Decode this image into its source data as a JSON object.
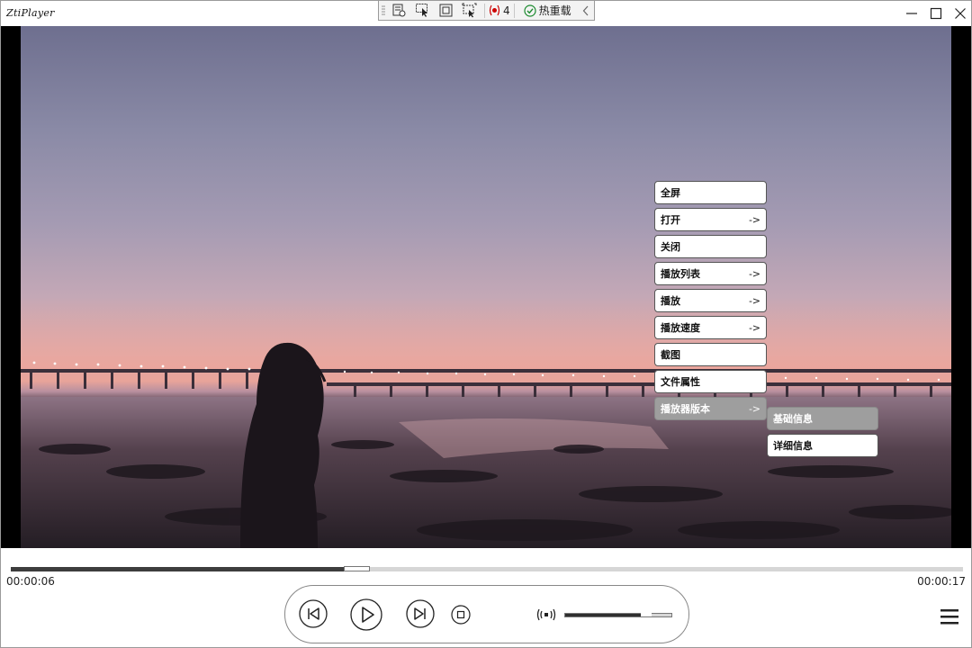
{
  "window": {
    "title": "ZtiPlayer"
  },
  "devbar": {
    "error_count": "4",
    "hot_reload_label": "热重载"
  },
  "context_menu": {
    "items": [
      {
        "label": "全屏",
        "has_sub": false
      },
      {
        "label": "打开",
        "has_sub": true
      },
      {
        "label": "关闭",
        "has_sub": false
      },
      {
        "label": "播放列表",
        "has_sub": true
      },
      {
        "label": "播放",
        "has_sub": true
      },
      {
        "label": "播放速度",
        "has_sub": true
      },
      {
        "label": "截图",
        "has_sub": false
      },
      {
        "label": "文件属性",
        "has_sub": false
      },
      {
        "label": "播放器版本",
        "has_sub": true
      }
    ],
    "submenu": [
      {
        "label": "基础信息"
      },
      {
        "label": "详细信息"
      }
    ],
    "arrow_glyph": "->"
  },
  "playback": {
    "current_time": "00:00:06",
    "duration": "00:00:17",
    "progress_fraction": 0.35
  },
  "volume": {
    "level_fraction": 0.73
  },
  "colors": {
    "accent": "#3d3d3d",
    "menu_active": "#9e9e9e"
  }
}
